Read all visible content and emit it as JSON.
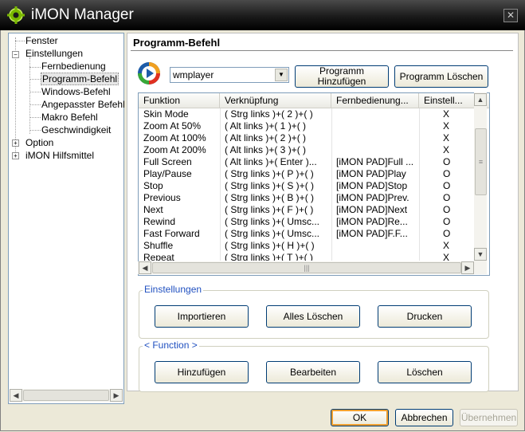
{
  "window": {
    "title": "iMON Manager"
  },
  "tree": {
    "items": [
      {
        "label": "Fenster"
      },
      {
        "label": "Einstellungen"
      },
      {
        "label": "Fernbedienung"
      },
      {
        "label": "Programm-Befehl"
      },
      {
        "label": "Windows-Befehl"
      },
      {
        "label": "Angepasster Befehl"
      },
      {
        "label": "Makro  Befehl"
      },
      {
        "label": "Geschwindigkeit"
      },
      {
        "label": "Option"
      },
      {
        "label": "iMON Hilfsmittel"
      }
    ]
  },
  "panel": {
    "title": "Programm-Befehl",
    "program_select": "wmplayer",
    "add_program_label": "Programm Hinzufügen",
    "delete_program_label": "Programm Löschen"
  },
  "list": {
    "columns": [
      "Funktion",
      "Verknüpfung",
      "Fernbedienung...",
      "Einstell..."
    ],
    "rows": [
      [
        "Skin Mode",
        "( Strg links )+( 2 )+(  )",
        "",
        "X"
      ],
      [
        "Zoom At 50%",
        "( Alt links )+( 1 )+(  )",
        "",
        "X"
      ],
      [
        "Zoom At 100%",
        "( Alt links )+( 2 )+(  )",
        "",
        "X"
      ],
      [
        "Zoom At 200%",
        "( Alt links )+( 3 )+(  )",
        "",
        "X"
      ],
      [
        "Full Screen",
        "( Alt links )+( Enter )...",
        "[iMON PAD]Full ...",
        "O"
      ],
      [
        "Play/Pause",
        "( Strg links )+( P )+(  )",
        "[iMON PAD]Play",
        "O"
      ],
      [
        "Stop",
        "( Strg links )+( S )+(  )",
        "[iMON PAD]Stop",
        "O"
      ],
      [
        "Previous",
        "( Strg links )+( B )+(  )",
        "[iMON PAD]Prev.",
        "O"
      ],
      [
        "Next",
        "( Strg links )+( F )+(  )",
        "[iMON PAD]Next",
        "O"
      ],
      [
        "Rewind",
        "( Strg links )+( Umsc...",
        "[iMON PAD]Re...",
        "O"
      ],
      [
        "Fast Forward",
        "( Strg links )+( Umsc...",
        "[iMON PAD]F.F...",
        "O"
      ],
      [
        "Shuffle",
        "( Strg links )+( H )+(  )",
        "",
        "X"
      ],
      [
        "Repeat",
        "( Strg links )+( T )+(  )",
        "",
        "X"
      ]
    ]
  },
  "settings_group": {
    "label": "Einstellungen",
    "import_label": "Importieren",
    "delete_all_label": "Alles Löschen",
    "print_label": "Drucken"
  },
  "function_group": {
    "label": "< Function >",
    "add_label": "Hinzufügen",
    "edit_label": "Bearbeiten",
    "delete_label": "Löschen"
  },
  "footer": {
    "ok_label": "OK",
    "cancel_label": "Abbrechen",
    "apply_label": "Übernehmen"
  },
  "colors": {
    "titlebar": "#000000",
    "group_label": "#2050c0",
    "accent_border": "#003c74",
    "ok_highlight": "#f0a030"
  }
}
